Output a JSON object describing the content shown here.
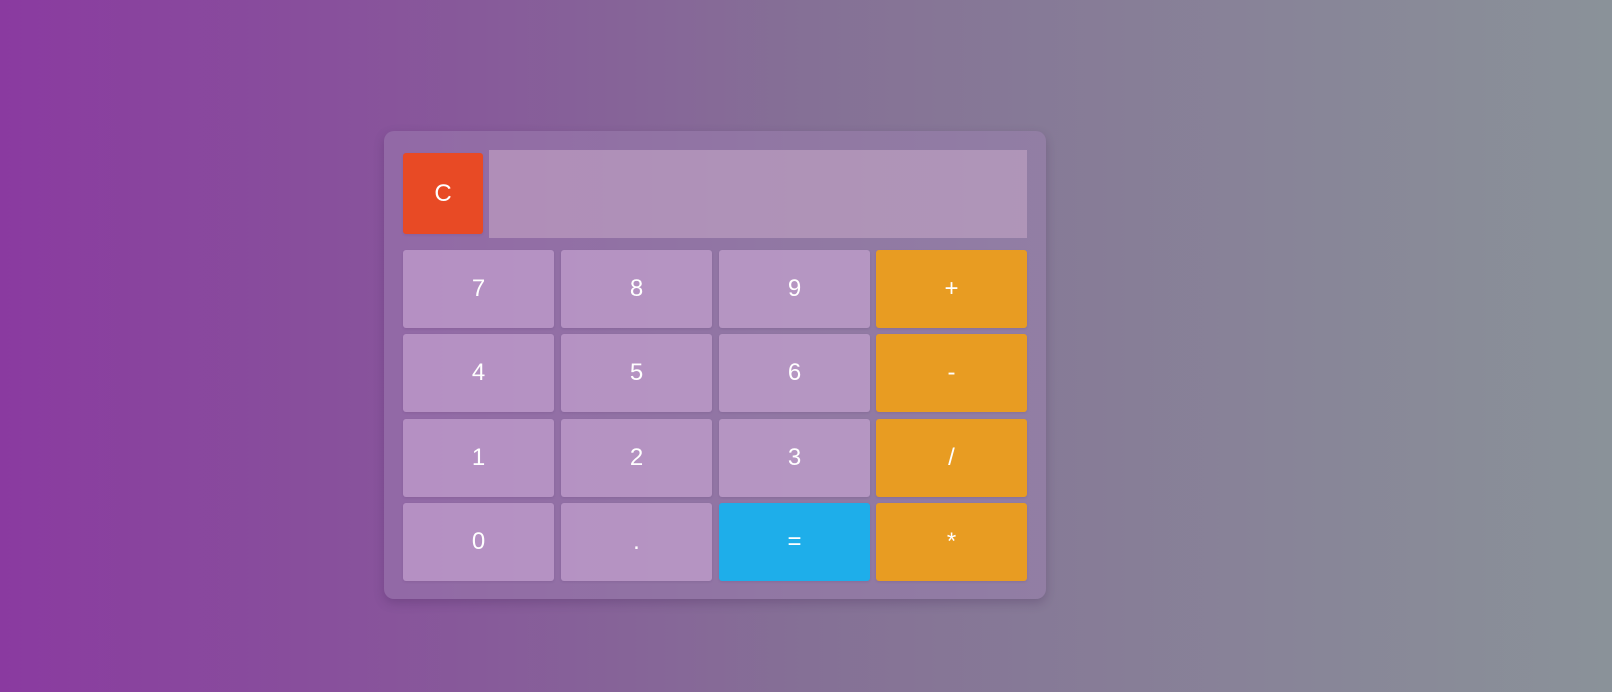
{
  "calculator": {
    "clear_label": "C",
    "display_value": "",
    "keys": {
      "k7": "7",
      "k8": "8",
      "k9": "9",
      "plus": "+",
      "k4": "4",
      "k5": "5",
      "k6": "6",
      "minus": "-",
      "k1": "1",
      "k2": "2",
      "k3": "3",
      "divide": "/",
      "k0": "0",
      "dot": ".",
      "equals": "=",
      "multiply": "*"
    }
  },
  "colors": {
    "clear": "#e84a25",
    "operator": "#e89c22",
    "equals": "#1eaeea"
  }
}
